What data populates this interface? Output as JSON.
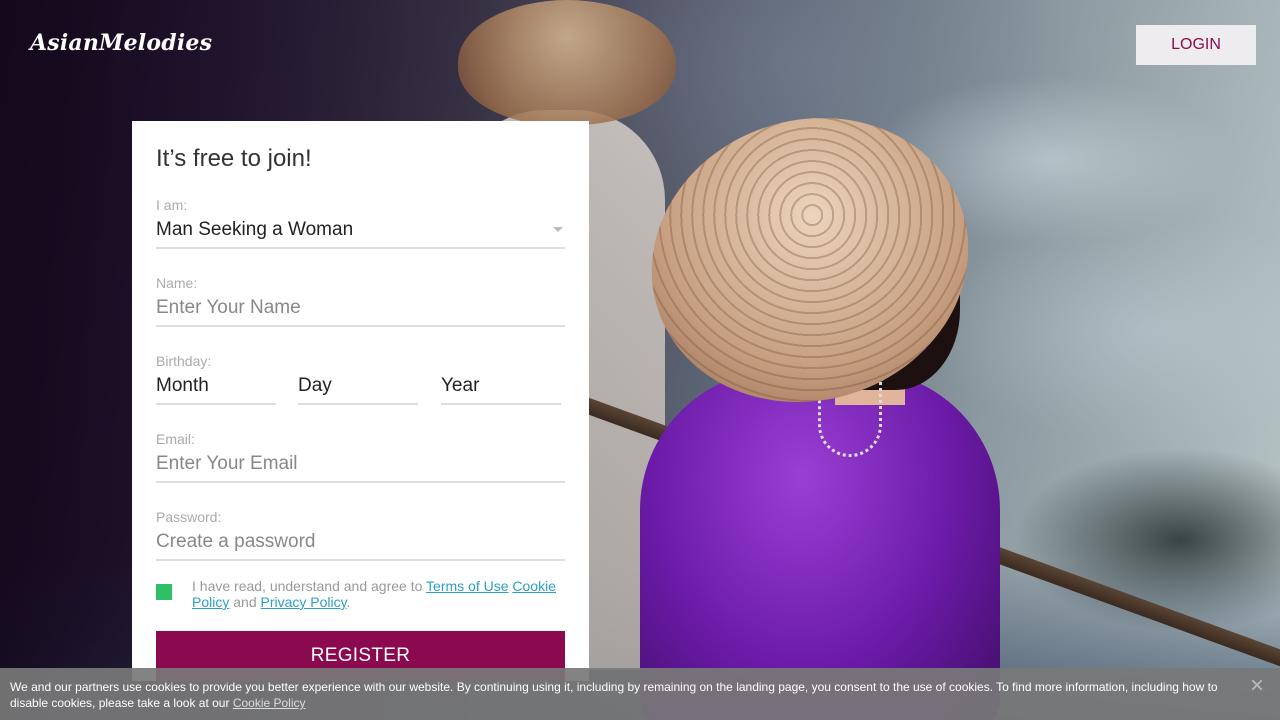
{
  "header": {
    "logo_text": "AsianMelodies",
    "login_label": "LOGIN"
  },
  "form": {
    "title": "It’s free to join!",
    "iam": {
      "label": "I am:",
      "value": "Man Seeking a Woman"
    },
    "name": {
      "label": "Name:",
      "placeholder": "Enter Your Name"
    },
    "birthday": {
      "label": "Birthday:",
      "month": "Month",
      "day": "Day",
      "year": "Year"
    },
    "email": {
      "label": "Email:",
      "placeholder": "Enter Your Email"
    },
    "password": {
      "label": "Password:",
      "placeholder": "Create a password"
    },
    "consent": {
      "checked": true,
      "text_before": "I have read, understand and agree to ",
      "terms_link": "Terms of Use",
      "cookie_link": "Cookie Policy",
      "and_text": " and ",
      "privacy_link": "Privacy Policy",
      "period": "."
    },
    "register_label": "REGISTER"
  },
  "cookie_bar": {
    "text": "We and our partners use cookies to provide you better experience with our website. By continuing using it, including by remaining on the landing page, you consent to the use of cookies. To find more information, including how to disable cookies, please take a look at our ",
    "link": "Cookie Policy",
    "close_icon": "close-icon"
  },
  "colors": {
    "brand": "#8b0a4f",
    "check": "#2fbf64",
    "link": "#2b9fc8"
  }
}
